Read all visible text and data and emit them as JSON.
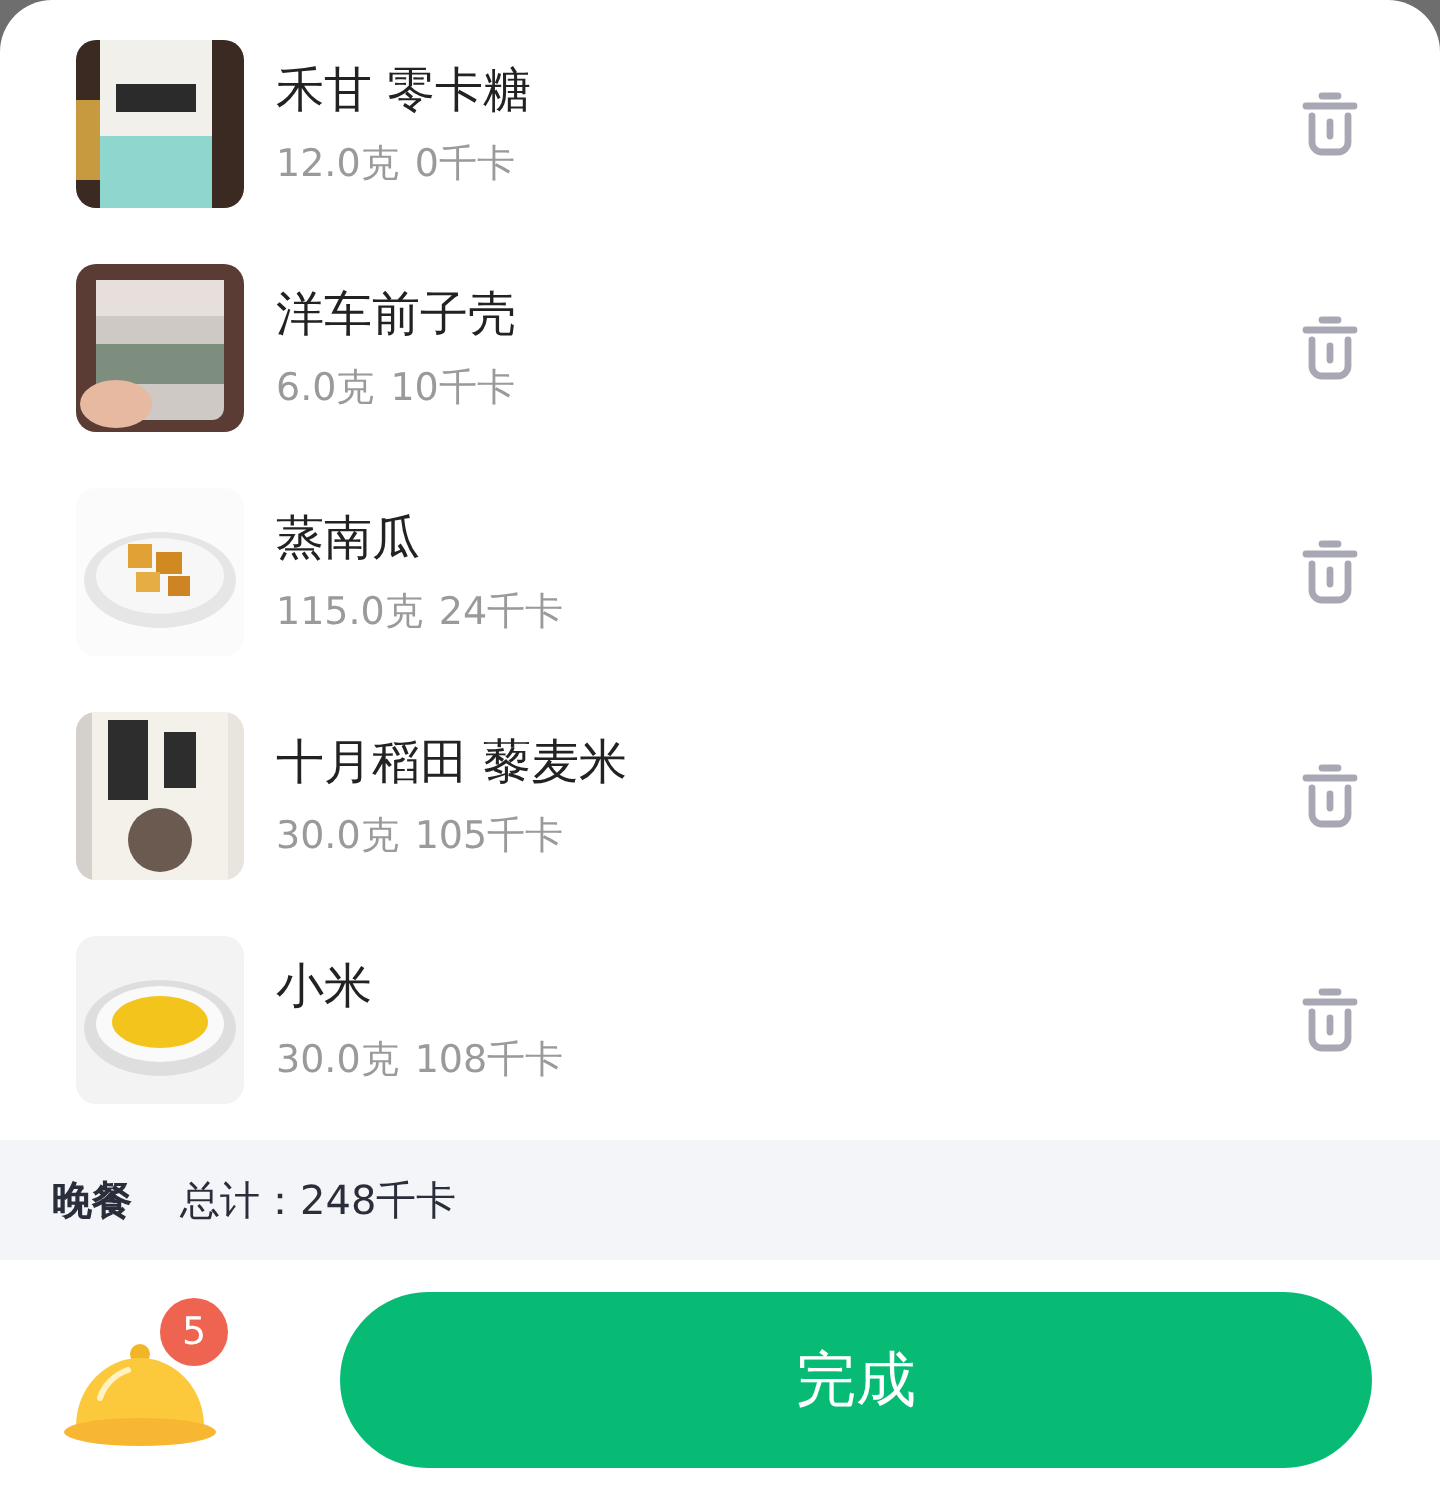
{
  "foods": [
    {
      "name": "禾甘 零卡糖",
      "amount": "12.0克",
      "calories": "0千卡",
      "kind": "picture"
    },
    {
      "name": "洋车前子壳",
      "amount": "6.0克",
      "calories": "10千卡",
      "kind": "picture"
    },
    {
      "name": "蒸南瓜",
      "amount": "115.0克",
      "calories": "24千卡",
      "kind": "picture"
    },
    {
      "name": "十月稻田 藜麦米",
      "amount": "30.0克",
      "calories": "105千卡",
      "kind": "picture"
    },
    {
      "name": "小米",
      "amount": "30.0克",
      "calories": "108千卡",
      "kind": "picture"
    }
  ],
  "summary": {
    "meal": "晚餐",
    "total": "总计：248千卡"
  },
  "cart": {
    "badge": "5"
  },
  "done_button": "完成"
}
